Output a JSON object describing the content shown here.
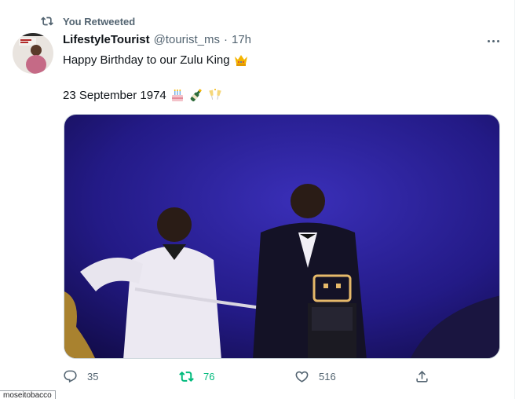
{
  "context": {
    "label": "You Retweeted",
    "icon": "retweet-icon"
  },
  "tweet": {
    "author_name": "LifestyleTourist",
    "handle": "@tourist_ms",
    "separator": "·",
    "time": "17h",
    "line1": "Happy Birthday to our Zulu King",
    "line1_emoji": [
      "crown-emoji"
    ],
    "line2": "23 September 1974",
    "line2_emoji": [
      "birthday-cake-emoji",
      "champagne-bottle-emoji",
      "clinking-glasses-emoji"
    ],
    "media_description_icon": "photo"
  },
  "actions": {
    "reply_count": "35",
    "retweet_count": "76",
    "like_count": "516",
    "retweet_active": true
  },
  "colors": {
    "retweet_active": "#00ba7c",
    "secondary_text": "#536471",
    "primary_text": "#0f1419"
  },
  "status_tooltip": "moseitobacco"
}
